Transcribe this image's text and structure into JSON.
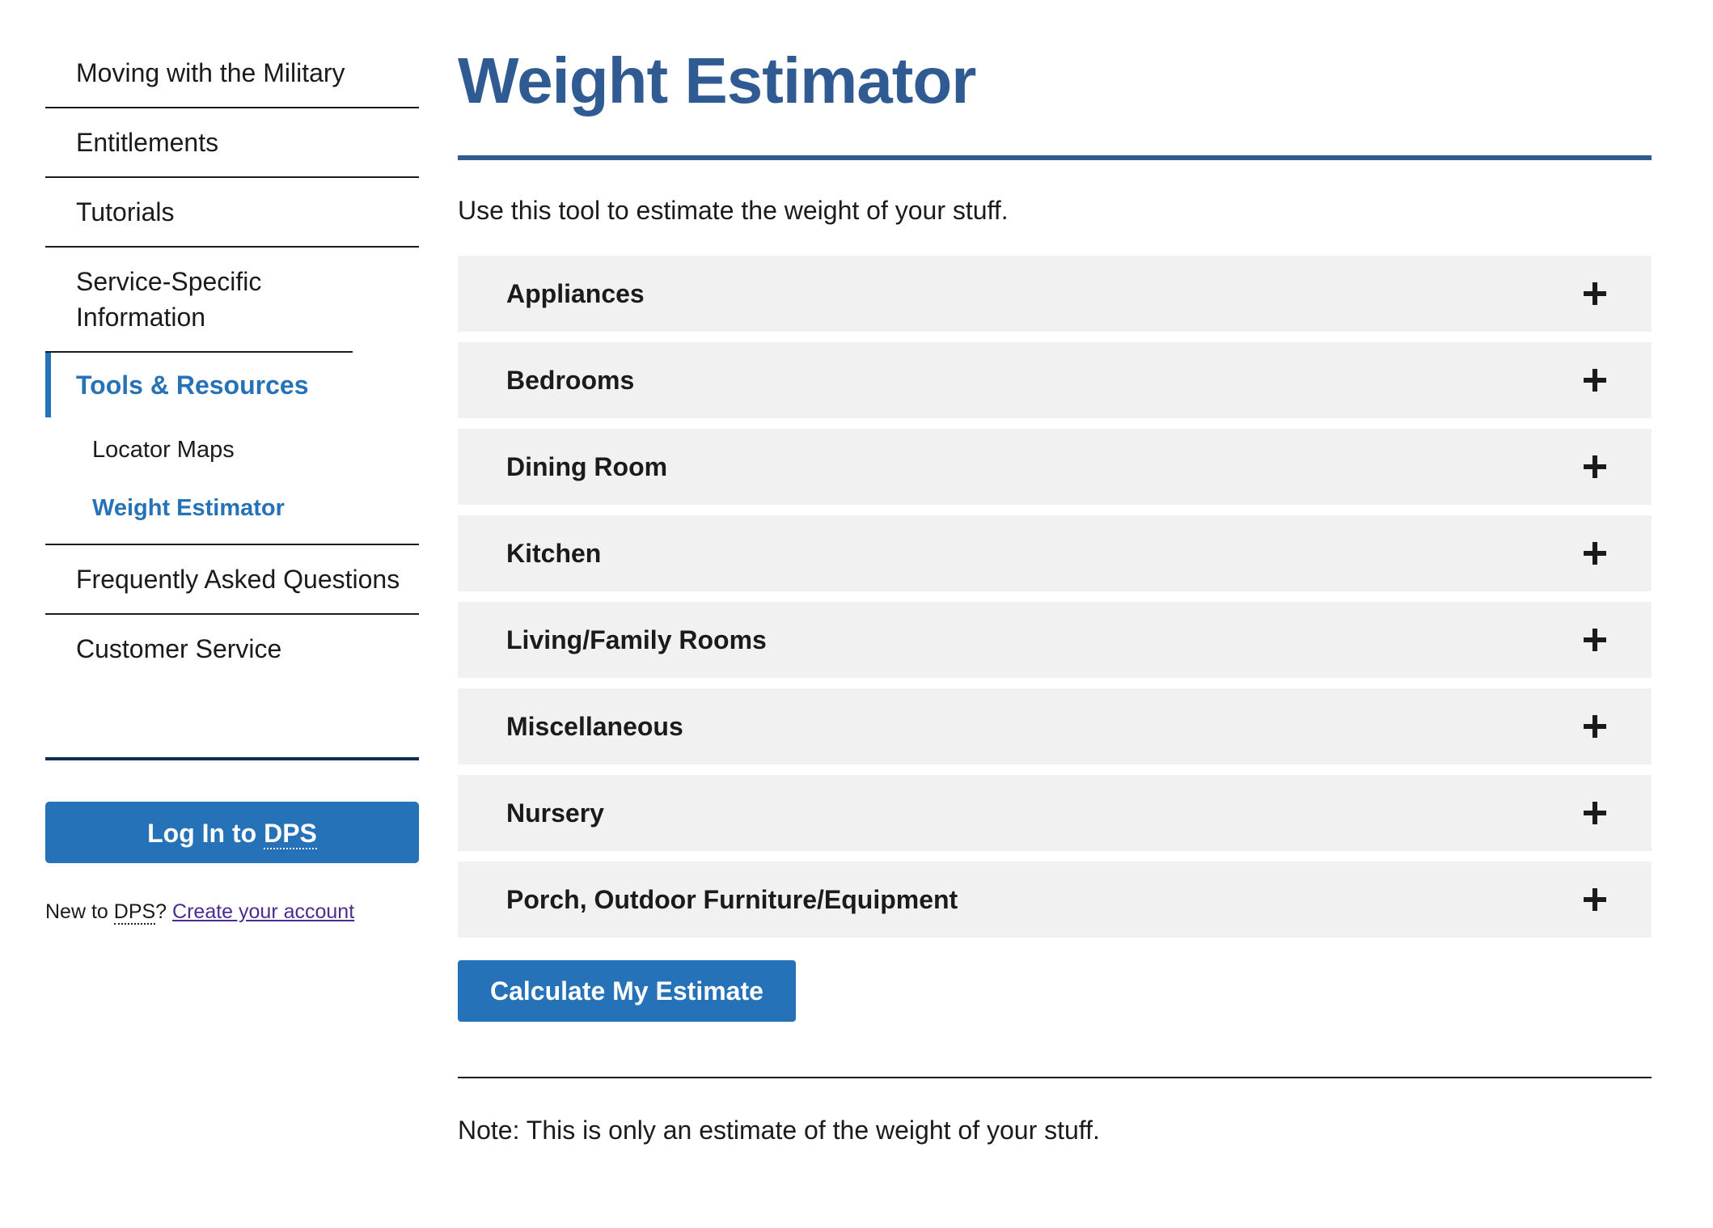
{
  "sidebar": {
    "nav": [
      {
        "label": "Moving with the Military"
      },
      {
        "label": "Entitlements"
      },
      {
        "label": "Tutorials"
      },
      {
        "label": "Service-Specific Information"
      }
    ],
    "active_section": {
      "label": "Tools & Resources",
      "children": [
        {
          "label": "Locator Maps"
        },
        {
          "label": "Weight Estimator"
        }
      ]
    },
    "nav_after": [
      {
        "label": "Frequently Asked Questions"
      },
      {
        "label": "Customer Service"
      }
    ],
    "login": {
      "prefix": "Log In to ",
      "abbr": "DPS"
    },
    "signup": {
      "prefix": "New to ",
      "abbr": "DPS",
      "suffix": "? ",
      "link": "Create your account"
    }
  },
  "main": {
    "title": "Weight Estimator",
    "intro": "Use this tool to estimate the weight of your stuff.",
    "accordion": [
      {
        "label": "Appliances"
      },
      {
        "label": "Bedrooms"
      },
      {
        "label": "Dining Room"
      },
      {
        "label": "Kitchen"
      },
      {
        "label": "Living/Family Rooms"
      },
      {
        "label": "Miscellaneous"
      },
      {
        "label": "Nursery"
      },
      {
        "label": "Porch, Outdoor Furniture/Equipment"
      }
    ],
    "calculate_label": "Calculate My Estimate",
    "note": "Note: This is only an estimate of the weight of your stuff."
  },
  "colors": {
    "brand_blue": "#2672b8",
    "title_blue": "#2f5a92",
    "accordion_bg": "#f1f1f1",
    "link_purple": "#4c2c92"
  },
  "icons": {
    "accordion_toggle": "plus-icon"
  }
}
